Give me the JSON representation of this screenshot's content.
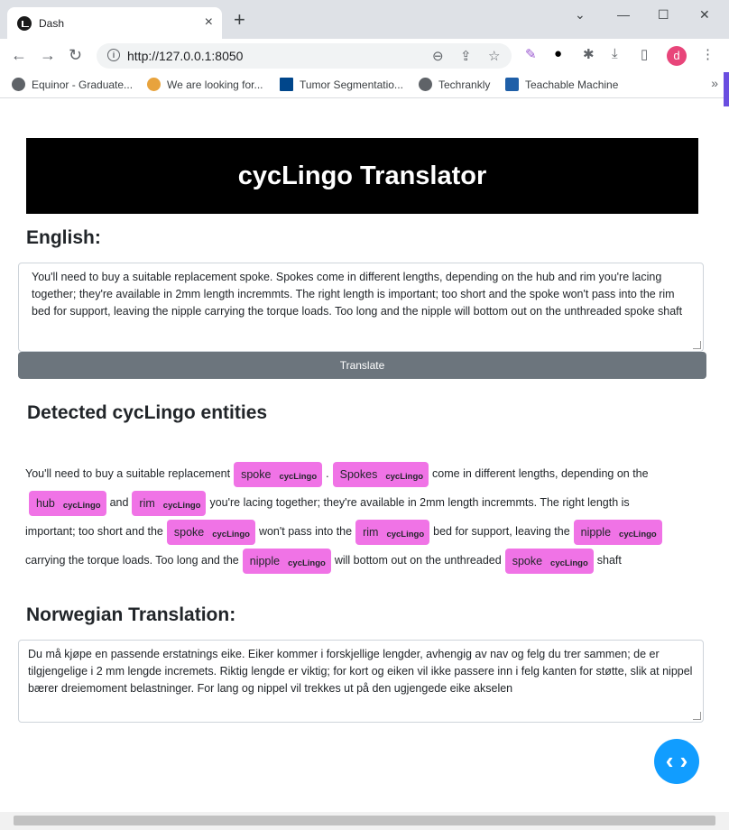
{
  "browser": {
    "tab_title": "Dash",
    "url": "http://127.0.0.1:8050",
    "avatar_letter": "d",
    "bookmarks": [
      "Equinor - Graduate...",
      "We are looking for...",
      "Tumor Segmentatio...",
      "Techrankly",
      "Teachable Machine"
    ]
  },
  "app": {
    "title": "cycLingo Translator",
    "english_label": "English:",
    "english_text": " You'll need to buy a suitable replacement spoke. Spokes come in different lengths, depending on the hub and rim you're lacing together; they're available in 2mm length incremmts. The right length is important; too short and the spoke won't pass into the rim bed for support, leaving the nipple carrying the torque loads. Too long and the nipple will bottom out on the unthreaded spoke shaft",
    "translate_label": "Translate",
    "entities_heading": "Detected cycLingo entities",
    "entity_tag": "cycLingo",
    "entity_lines": [
      [
        {
          "t": "You'll need to buy a suitable replacement"
        },
        {
          "e": "spoke"
        },
        {
          "t": "."
        },
        {
          "e": "Spokes"
        },
        {
          "t": "come in different lengths, depending on the"
        }
      ],
      [
        {
          "e": "hub"
        },
        {
          "t": "and"
        },
        {
          "e": "rim"
        },
        {
          "t": "you're lacing together; they're available in 2mm length incremmts. The right length is"
        }
      ],
      [
        {
          "t": "important; too short and the"
        },
        {
          "e": "spoke"
        },
        {
          "t": "won't pass into the"
        },
        {
          "e": "rim"
        },
        {
          "t": "bed for support, leaving the"
        },
        {
          "e": "nipple"
        }
      ],
      [
        {
          "t": "carrying the torque loads. Too long and the"
        },
        {
          "e": "nipple"
        },
        {
          "t": "will bottom out on the unthreaded"
        },
        {
          "e": "spoke"
        },
        {
          "t": "shaft"
        }
      ]
    ],
    "norwegian_label": "Norwegian Translation:",
    "norwegian_text": "Du må kjøpe en passende erstatnings eike. Eiker kommer i forskjellige lengder, avhengig av nav og felg du trer sammen; de er tilgjengelige i 2 mm lengde incremets. Riktig lengde er viktig; for kort og eiken vil ikke passere inn i felg kanten for støtte, slik at nippel bærer dreiemoment belastninger. For lang og nippel vil trekkes ut på den ugjengede eike akselen",
    "entity_color": "#f073e6",
    "header_color": "#000000",
    "button_color": "#6c757d"
  }
}
